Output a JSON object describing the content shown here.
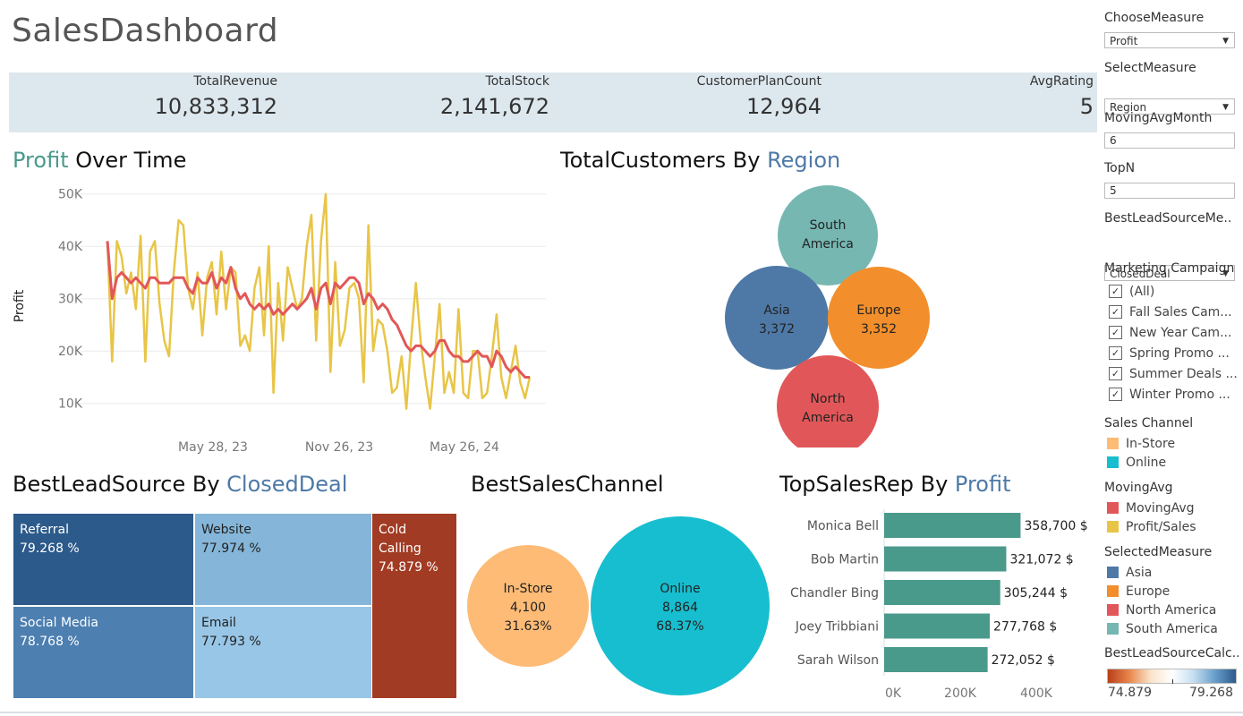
{
  "header": {
    "title": "SalesDashboard"
  },
  "kpis": [
    {
      "label": "TotalRevenue",
      "value": "10,833,312"
    },
    {
      "label": "TotalStock",
      "value": "2,141,672"
    },
    {
      "label": "CustomerPlanCount",
      "value": "12,964"
    },
    {
      "label": "AvgRating",
      "value": "5"
    }
  ],
  "profit_over_time": {
    "title_measure": "Profit",
    "title_rest": " Over Time",
    "chart_data": {
      "type": "line",
      "ylabel": "Profit",
      "y_ticks": [
        "10K",
        "20K",
        "30K",
        "40K",
        "50K"
      ],
      "x_ticks": [
        "May 28, 23",
        "Nov 26, 23",
        "May 26, 24"
      ],
      "ylim": [
        5000,
        52000
      ],
      "series": [
        {
          "name": "Profit/Sales",
          "color": "#e8c547",
          "values": [
            41000,
            18000,
            41000,
            38000,
            31000,
            35000,
            28000,
            42000,
            18000,
            39000,
            41000,
            29000,
            22000,
            19000,
            35000,
            45000,
            44000,
            32000,
            28000,
            35000,
            23000,
            34000,
            37000,
            27000,
            39000,
            28000,
            36000,
            35000,
            21000,
            23000,
            20000,
            32000,
            36000,
            23000,
            40000,
            12000,
            33000,
            22000,
            36000,
            32000,
            28000,
            30000,
            40000,
            46000,
            22000,
            41000,
            50000,
            16000,
            37000,
            21000,
            24000,
            32000,
            33000,
            30000,
            14000,
            44000,
            20000,
            26000,
            25000,
            20000,
            12000,
            13000,
            19000,
            9000,
            22000,
            33000,
            22000,
            15000,
            9000,
            19000,
            29000,
            12000,
            16000,
            12000,
            28000,
            12000,
            11000,
            20000,
            20000,
            11000,
            12000,
            19000,
            27000,
            15000,
            11000,
            16000,
            21000,
            14000,
            11000,
            15000
          ]
        },
        {
          "name": "MovingAvg",
          "color": "#e15759",
          "values": [
            41000,
            30000,
            34000,
            35000,
            34000,
            33000,
            34000,
            33000,
            32000,
            34000,
            34000,
            33000,
            33000,
            33000,
            34000,
            34000,
            34000,
            32000,
            31000,
            34000,
            33000,
            33000,
            35000,
            32000,
            34000,
            33000,
            36000,
            32000,
            30000,
            31000,
            29000,
            28000,
            29000,
            28000,
            29000,
            27000,
            28000,
            27000,
            28000,
            29000,
            28000,
            29000,
            30000,
            32000,
            28000,
            32000,
            33000,
            29000,
            33000,
            32000,
            33000,
            34000,
            34000,
            33000,
            29000,
            31000,
            30000,
            28000,
            29000,
            28000,
            26000,
            25000,
            23000,
            21000,
            20000,
            21000,
            21000,
            20000,
            19000,
            20000,
            22000,
            22000,
            20000,
            19000,
            19000,
            18000,
            18000,
            19000,
            20000,
            19000,
            19000,
            17000,
            20000,
            19000,
            17000,
            16000,
            17000,
            16000,
            15000,
            15000
          ]
        }
      ]
    }
  },
  "customers_by_region": {
    "title_prefix": "TotalCustomers By ",
    "title_measure": "Region",
    "chart_data": {
      "type": "bubble",
      "items": [
        {
          "label": "South",
          "label2": "America",
          "value_text": "",
          "color": "#76b7b2"
        },
        {
          "label": "Asia",
          "label2": "",
          "value_text": "3,372",
          "color": "#4e79a7"
        },
        {
          "label": "Europe",
          "label2": "",
          "value_text": "3,352",
          "color": "#f28e2b"
        },
        {
          "label": "North",
          "label2": "America",
          "value_text": "",
          "color": "#e15759"
        }
      ]
    }
  },
  "lead_source": {
    "title_prefix": "BestLeadSource By ",
    "title_measure": "ClosedDeal",
    "chart_data": {
      "type": "treemap",
      "cells": [
        {
          "name": "Referral",
          "pct": "79.268 %",
          "color": "#2c5a8a"
        },
        {
          "name": "Website",
          "pct": "77.974 %",
          "color": "#85b6d9"
        },
        {
          "name": "Social Media",
          "pct": "78.768 %",
          "color": "#4d7fb0"
        },
        {
          "name": "Email",
          "pct": "77.793 %",
          "color": "#98c6e6"
        },
        {
          "name": "Cold",
          "name2": "Calling",
          "pct": "74.879 %",
          "color": "#a23b23"
        }
      ]
    }
  },
  "sales_channel": {
    "title": "BestSalesChannel",
    "chart_data": {
      "type": "bubble",
      "items": [
        {
          "label": "In-Store",
          "value": "4,100",
          "pct": "31.63%",
          "color": "#fdbb76"
        },
        {
          "label": "Online",
          "value": "8,864",
          "pct": "68.37%",
          "color": "#17becf"
        }
      ]
    }
  },
  "top_sales_rep": {
    "title_prefix": "TopSalesRep By ",
    "title_measure": "Profit",
    "chart_data": {
      "type": "bar",
      "categories": [
        "Monica Bell",
        "Bob Martin",
        "Chandler Bing",
        "Joey Tribbiani",
        "Sarah Wilson"
      ],
      "values": [
        358700,
        321072,
        305244,
        277768,
        272052
      ],
      "value_labels": [
        "358,700 $",
        "321,072 $",
        "305,244 $",
        "277,768 $",
        "272,052 $"
      ],
      "x_ticks": [
        "0K",
        "200K",
        "400K"
      ],
      "xlim": [
        0,
        400000
      ],
      "color": "#4a9a8c"
    }
  },
  "sidebar": {
    "choose_measure": {
      "title": "ChooseMeasure",
      "value": "Profit"
    },
    "select_measure": {
      "title": "SelectMeasure",
      "value": "Region"
    },
    "moving_avg_month": {
      "title": "MovingAvgMonth",
      "value": "6"
    },
    "top_n": {
      "title": "TopN",
      "value": "5"
    },
    "best_lead_measure": {
      "title": "BestLeadSourceMe..",
      "value": "ClosedDeal"
    },
    "campaign": {
      "title": "Marketing Campaign",
      "items": [
        "(All)",
        "Fall Sales Cam...",
        "New Year Cam...",
        "Spring Promo ...",
        "Summer Deals ...",
        "Winter Promo ..."
      ]
    },
    "sales_channel_legend": {
      "title": "Sales Channel",
      "items": [
        {
          "label": "In-Store",
          "color": "#fdbb76"
        },
        {
          "label": "Online",
          "color": "#17becf"
        }
      ]
    },
    "moving_avg_legend": {
      "title": "MovingAvg",
      "items": [
        {
          "label": "MovingAvg",
          "color": "#e15759"
        },
        {
          "label": "Profit/Sales",
          "color": "#e8c547"
        }
      ]
    },
    "selected_measure_legend": {
      "title": "SelectedMeasure",
      "items": [
        {
          "label": "Asia",
          "color": "#4e79a7"
        },
        {
          "label": "Europe",
          "color": "#f28e2b"
        },
        {
          "label": "North America",
          "color": "#e15759"
        },
        {
          "label": "South America",
          "color": "#76b7b2"
        }
      ]
    },
    "gradient_legend": {
      "title": "BestLeadSourceCalc..",
      "min": "74.879",
      "max": "79.268"
    }
  }
}
